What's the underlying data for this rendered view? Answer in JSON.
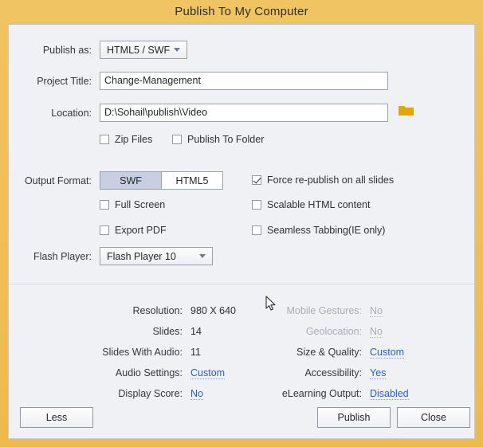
{
  "window": {
    "title": "Publish To My Computer",
    "frame_color": "#eeba4f",
    "panel_bg": "#eff1f5"
  },
  "form": {
    "publish_as": {
      "label": "Publish as:",
      "value": "HTML5 / SWF",
      "icon": "chevron-down-icon"
    },
    "project_title": {
      "label": "Project Title:",
      "value": "Change-Management"
    },
    "location": {
      "label": "Location:",
      "value": "D:\\Sohail\\publish\\Video",
      "browse_icon": "folder-icon",
      "browse_icon_color": "#e2a60a"
    },
    "zip_files": {
      "label": "Zip Files",
      "checked": false
    },
    "publish_to_folder": {
      "label": "Publish To Folder",
      "checked": false
    },
    "output_format": {
      "label": "Output Format:",
      "options": [
        "SWF",
        "HTML5"
      ],
      "selected": "SWF"
    },
    "full_screen": {
      "label": "Full Screen",
      "checked": false
    },
    "export_pdf": {
      "label": "Export PDF",
      "checked": false
    },
    "force_republish": {
      "label": "Force re-publish on all slides",
      "checked": true
    },
    "scalable_html": {
      "label": "Scalable HTML content",
      "checked": false
    },
    "seamless_tabbing": {
      "label": "Seamless Tabbing(IE only)",
      "checked": false
    },
    "flash_player": {
      "label": "Flash Player:",
      "value": "Flash Player 10",
      "icon": "chevron-down-icon"
    }
  },
  "info": {
    "left": [
      {
        "label": "Resolution:",
        "value": "980 X 640",
        "link": false,
        "dim": false
      },
      {
        "label": "Slides:",
        "value": "14",
        "link": false,
        "dim": false
      },
      {
        "label": "Slides With Audio:",
        "value": "11",
        "link": false,
        "dim": false
      },
      {
        "label": "Audio Settings:",
        "value": "Custom",
        "link": true,
        "dim": false
      },
      {
        "label": "Display Score:",
        "value": "No",
        "link": true,
        "dim": false
      }
    ],
    "right": [
      {
        "label": "Mobile Gestures:",
        "value": "No",
        "link": false,
        "dim": true
      },
      {
        "label": "Geolocation:",
        "value": "No",
        "link": false,
        "dim": true
      },
      {
        "label": "Size & Quality:",
        "value": "Custom",
        "link": true,
        "dim": false
      },
      {
        "label": "Accessibility:",
        "value": "Yes",
        "link": true,
        "dim": false
      },
      {
        "label": "eLearning Output:",
        "value": "Disabled",
        "link": true,
        "dim": false
      }
    ]
  },
  "buttons": {
    "less": "Less",
    "publish": "Publish",
    "close": "Close"
  }
}
